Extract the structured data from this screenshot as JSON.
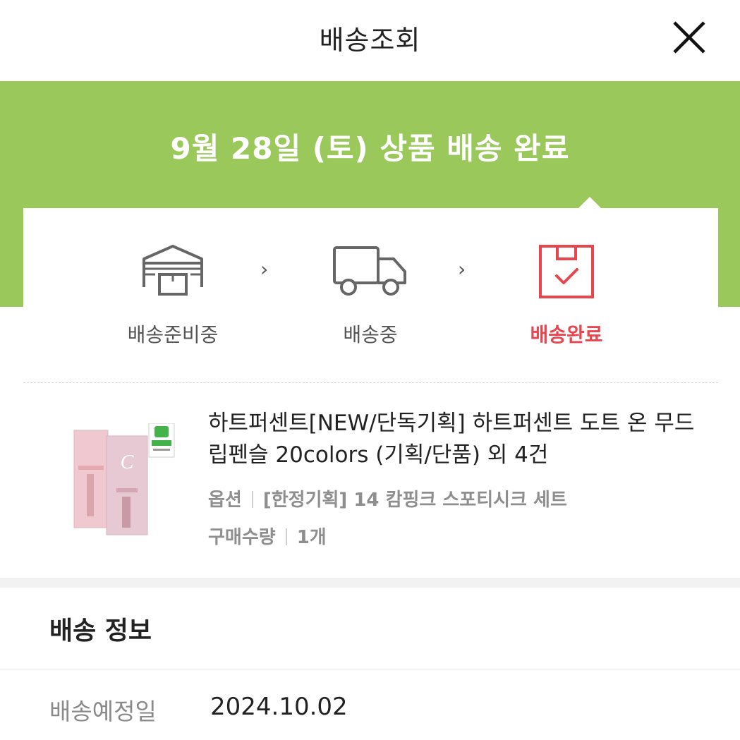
{
  "header": {
    "title": "배송조회"
  },
  "banner": {
    "title": "9월 28일 (토) 상품 배송 완료"
  },
  "steps": [
    {
      "label": "배송준비중",
      "icon": "warehouse-icon"
    },
    {
      "label": "배송중",
      "icon": "truck-icon"
    },
    {
      "label": "배송완료",
      "icon": "box-check-icon"
    }
  ],
  "step_arrow": "›",
  "product": {
    "name": "하트퍼센트[NEW/단독기획] 하트퍼센트 도트 온 무드 립펜슬 20colors (기획/단품) 외 4건",
    "option_label": "옵션",
    "option_value": "[한정기획] 14 캄핑크 스포티시크 세트",
    "qty_label": "구매수량",
    "qty_value": "1개"
  },
  "delivery_info": {
    "title": "배송 정보",
    "expected_date_label": "배송예정일",
    "expected_date_value": "2024.10.02"
  },
  "colors": {
    "banner_green": "#9ac85a",
    "active_red": "#e8464e",
    "inactive_gray": "#555555"
  }
}
